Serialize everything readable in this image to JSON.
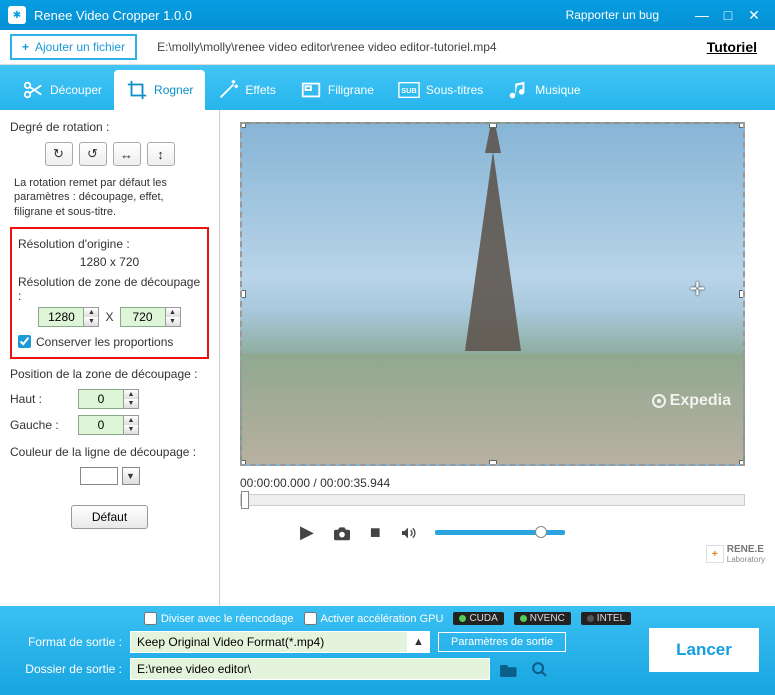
{
  "titlebar": {
    "app_title": "Renee Video Cropper 1.0.0",
    "report_bug": "Rapporter un bug"
  },
  "filebar": {
    "add_file": "Ajouter un fichier",
    "path": "E:\\molly\\molly\\renee video editor\\renee video editor-tutoriel.mp4",
    "tutorial": "Tutoriel"
  },
  "tabs": {
    "cut": "Découper",
    "crop": "Rogner",
    "effects": "Effets",
    "watermark": "Filigrane",
    "subtitles": "Sous-titres",
    "music": "Musique"
  },
  "sidebar": {
    "rotation_label": "Degré de rotation :",
    "rotation_note": "La rotation remet par défaut les paramètres : découpage, effet, filigrane et sous-titre.",
    "orig_res_label": "Résolution d'origine :",
    "orig_res_value": "1280 x 720",
    "crop_res_label": "Résolution de zone de découpage :",
    "width": "1280",
    "x_sep": "X",
    "height": "720",
    "keep_ratio": "Conserver les proportions",
    "pos_label": "Position de la zone de découpage :",
    "top_label": "Haut :",
    "top_val": "0",
    "left_label": "Gauche :",
    "left_val": "0",
    "line_color_label": "Couleur de la ligne de découpage :",
    "default_btn": "Défaut"
  },
  "preview": {
    "time_current": "00:00:00.000",
    "time_total": "00:00:35.944",
    "watermark": "Expedia",
    "brand": "RENE.E",
    "brand_sub": "Laboratory"
  },
  "bottom": {
    "divide": "Diviser avec le réencodage",
    "gpu": "Activer accélération GPU",
    "cuda": "CUDA",
    "nvenc": "NVENC",
    "intel": "INTEL",
    "format_label": "Format de sortie :",
    "format_value": "Keep Original Video Format(*.mp4)",
    "params_btn": "Paramètres de sortie",
    "folder_label": "Dossier de sortie :",
    "folder_value": "E:\\renee video editor\\",
    "launch": "Lancer"
  }
}
